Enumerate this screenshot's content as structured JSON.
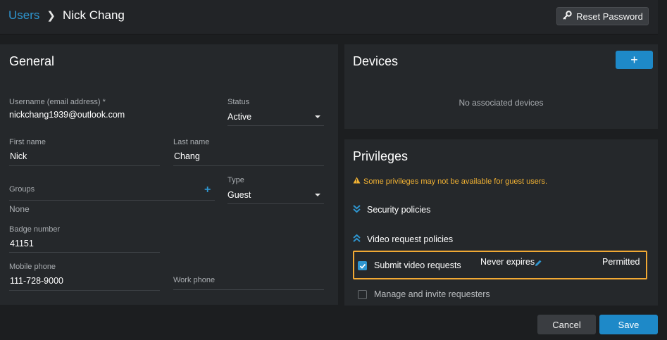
{
  "header": {
    "breadcrumb_parent": "Users",
    "breadcrumb_current": "Nick Chang",
    "reset_password_label": "Reset Password"
  },
  "general": {
    "title": "General",
    "username_label": "Username (email address) *",
    "username_value": "nickchang1939@outlook.com",
    "status_label": "Status",
    "status_value": "Active",
    "first_name_label": "First name",
    "first_name_value": "Nick",
    "last_name_label": "Last name",
    "last_name_value": "Chang",
    "groups_label": "Groups",
    "groups_value": "None",
    "type_label": "Type",
    "type_value": "Guest",
    "badge_label": "Badge number",
    "badge_value": "41151",
    "mobile_label": "Mobile phone",
    "mobile_value": "111-728-9000",
    "work_label": "Work phone",
    "work_value": ""
  },
  "devices": {
    "title": "Devices",
    "add_label": "+",
    "empty_text": "No associated devices"
  },
  "privileges": {
    "title": "Privileges",
    "warning": "Some privileges may not be available for guest users.",
    "security_policies": "Security policies",
    "video_request_policies": "Video request policies",
    "rows": [
      {
        "label": "Submit video requests",
        "expiry": "Never expires",
        "status": "Permitted",
        "checked": true
      },
      {
        "label": "Manage and invite requesters",
        "checked": false
      }
    ]
  },
  "footer": {
    "cancel_label": "Cancel",
    "save_label": "Save"
  },
  "colors": {
    "accent": "#1e89c8",
    "warning": "#f2b233",
    "highlight": "#f1a934"
  }
}
